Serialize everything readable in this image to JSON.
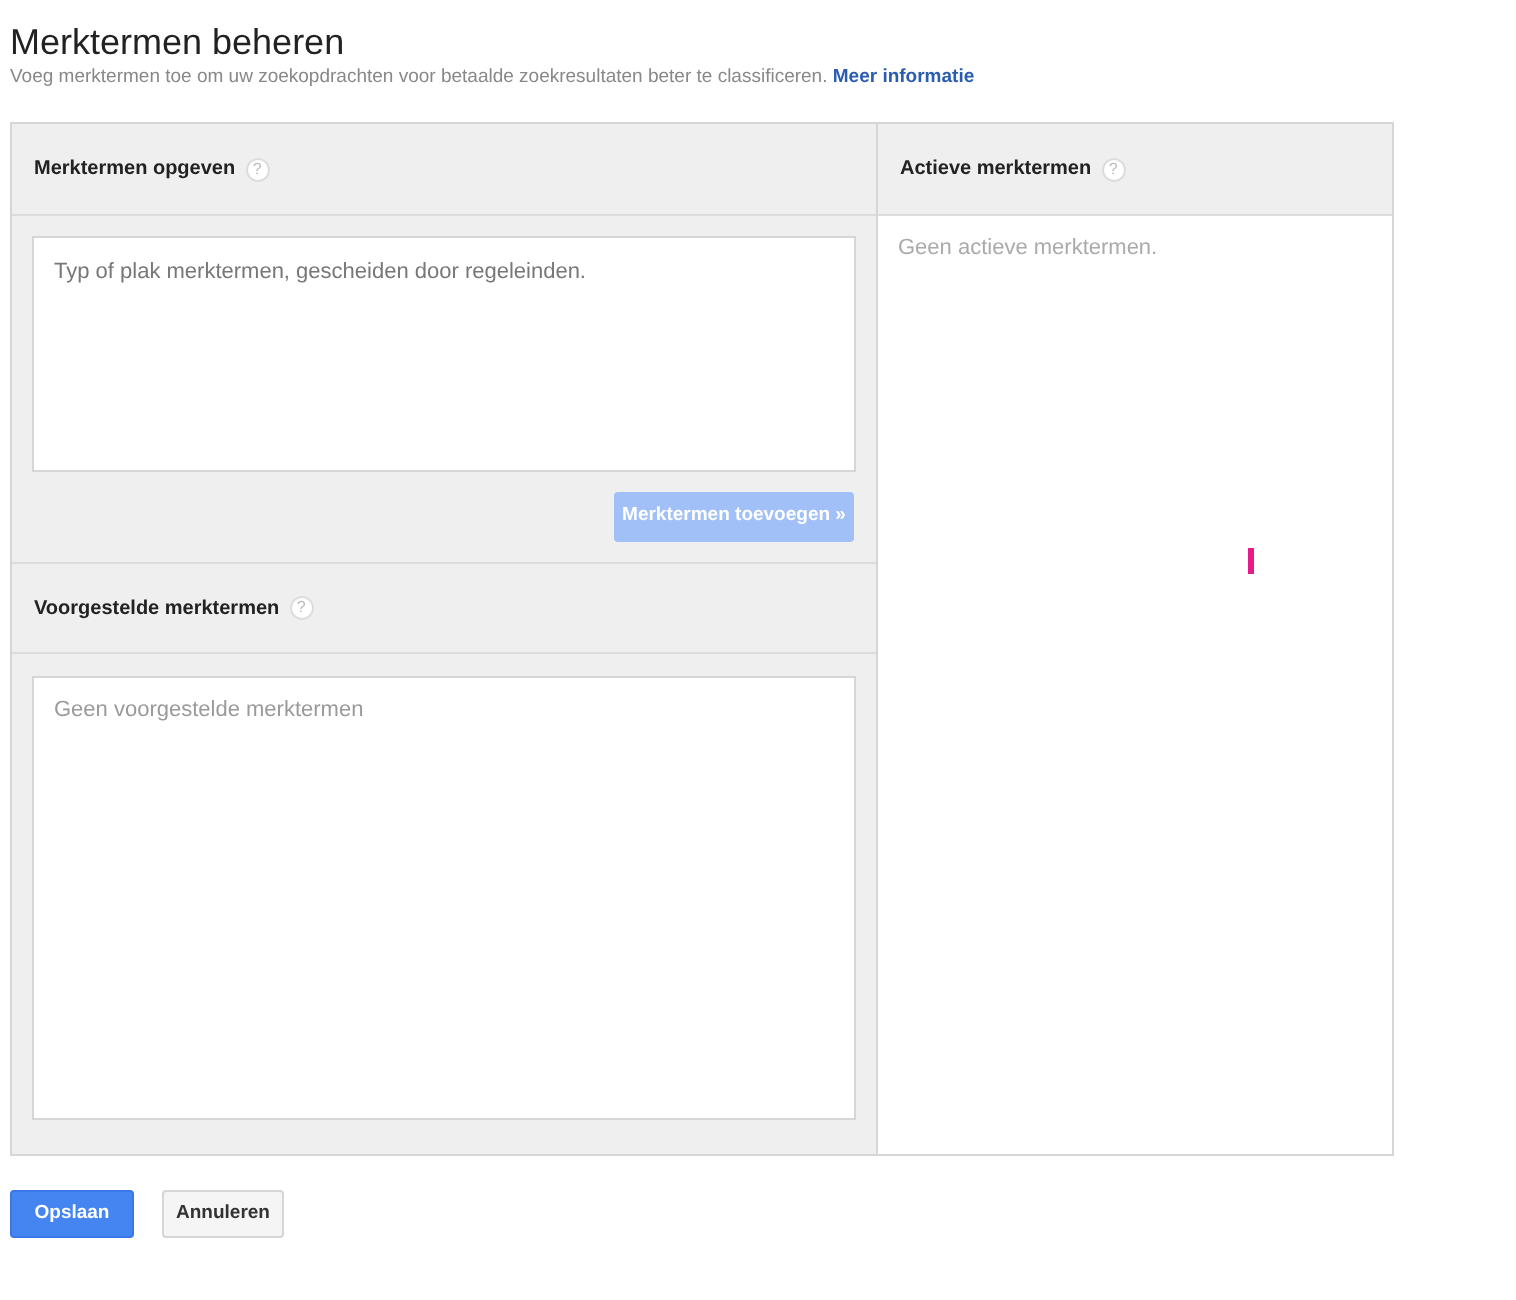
{
  "page": {
    "title": "Merktermen beheren",
    "description": "Voeg merktermen toe om uw zoekopdrachten voor betaalde zoekresultaten beter te classificeren.",
    "link": "Meer informatie"
  },
  "enter_panel": {
    "heading": "Merktermen opgeven",
    "help": "?",
    "placeholder": "Typ of plak merktermen, gescheiden door regeleinden.",
    "add_button": {
      "label": "Merktermen toevoegen »",
      "disabled": true
    }
  },
  "suggested_panel": {
    "heading": "Voorgestelde merktermen",
    "help": "?",
    "empty_text": "Geen voorgestelde merktermen"
  },
  "active_panel": {
    "heading": "Actieve merktermen",
    "help": "?",
    "empty_text": "Geen actieve merktermen."
  },
  "buttons": [
    {
      "label": "Opslaan",
      "kind": "primary"
    },
    {
      "label": "Annuleren",
      "kind": "secondary"
    }
  ]
}
